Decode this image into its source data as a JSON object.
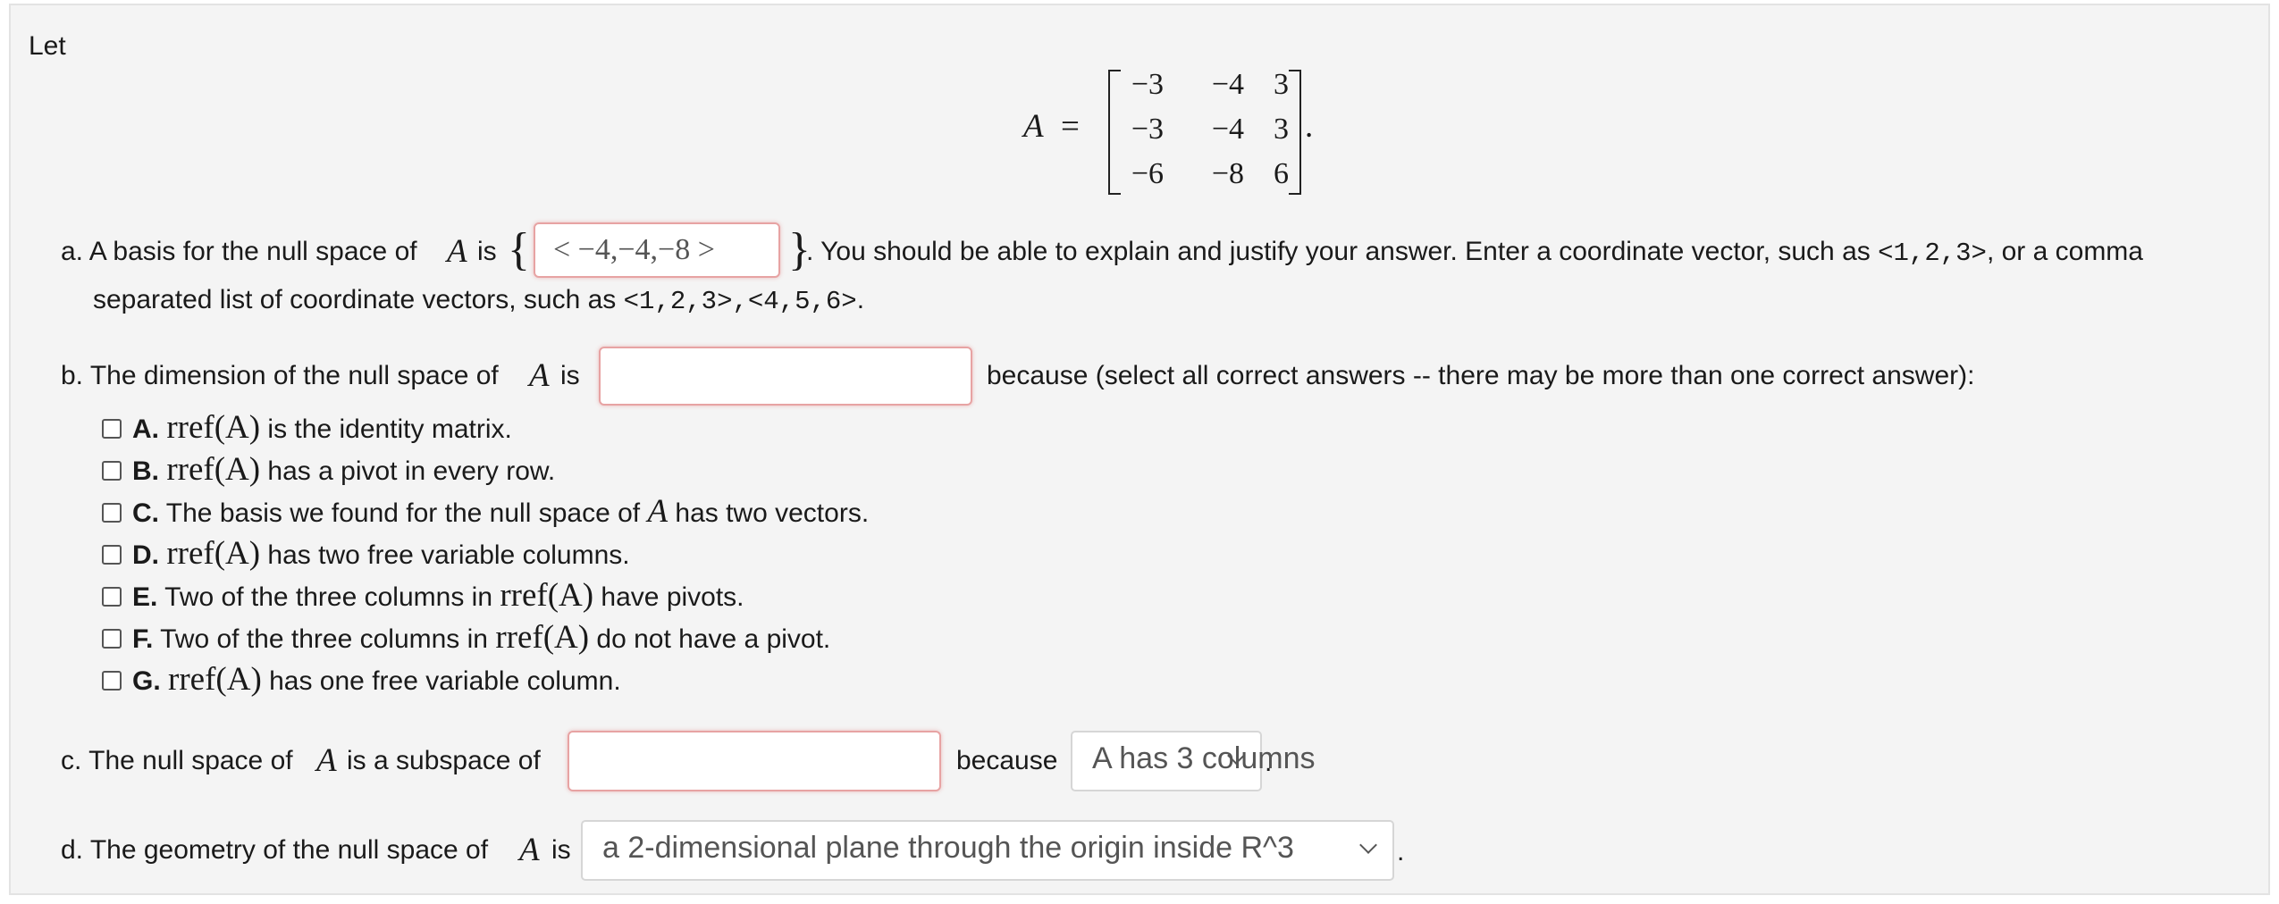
{
  "intro": "Let",
  "matrix": {
    "label": "A",
    "equals": "=",
    "period": ".",
    "rows": [
      [
        "−3",
        "−4",
        "3"
      ],
      [
        "−3",
        "−4",
        "3"
      ],
      [
        "−6",
        "−8",
        "6"
      ]
    ]
  },
  "part_a": {
    "prefix": "a. A basis for the null space of",
    "var": "A",
    "is": "is",
    "brace_open": "{",
    "brace_close": "}",
    "answer": "< −4,−4,−8 >",
    "after": ". You should be able to explain and justify your answer. Enter a coordinate vector, such as",
    "ex1": "<1,2,3>",
    "after2": ", or a comma",
    "line2": "separated list of coordinate vectors, such as",
    "ex2": "<1,2,3>,<4,5,6>",
    "end": "."
  },
  "part_b": {
    "prefix": "b. The dimension of the null space of",
    "var": "A",
    "is": "is",
    "answer": "",
    "after": "because (select all correct answers -- there may be more than one correct answer):",
    "choices": [
      {
        "letter": "A.",
        "math": "rref(A)",
        "text": " is the identity matrix."
      },
      {
        "letter": "B.",
        "math": "rref(A)",
        "text": " has a pivot in every row."
      },
      {
        "letter": "C.",
        "pre": " The basis we found for the null space of ",
        "var": "A",
        "text": " has two vectors."
      },
      {
        "letter": "D.",
        "math": "rref(A)",
        "text": " has two free variable columns."
      },
      {
        "letter": "E.",
        "pre": " Two of the three columns in ",
        "math": "rref(A)",
        "text": " have pivots."
      },
      {
        "letter": "F.",
        "pre": " Two of the three columns in ",
        "math": "rref(A)",
        "text": " do not have a pivot."
      },
      {
        "letter": "G.",
        "math": "rref(A)",
        "text": " has one free variable column."
      }
    ]
  },
  "part_c": {
    "prefix": "c. The null space of",
    "var": "A",
    "is": "is a subspace of",
    "answer": "",
    "because": "because",
    "select_value": "A has 3 columns",
    "end": "."
  },
  "part_d": {
    "prefix": "d. The geometry of the null space of",
    "var": "A",
    "is": "is",
    "select_value": "a 2-dimensional plane through the origin inside R^3",
    "end": "."
  },
  "colors": {
    "panel_bg": "#f4f4f4",
    "answer_border": "#e7a3a3"
  }
}
